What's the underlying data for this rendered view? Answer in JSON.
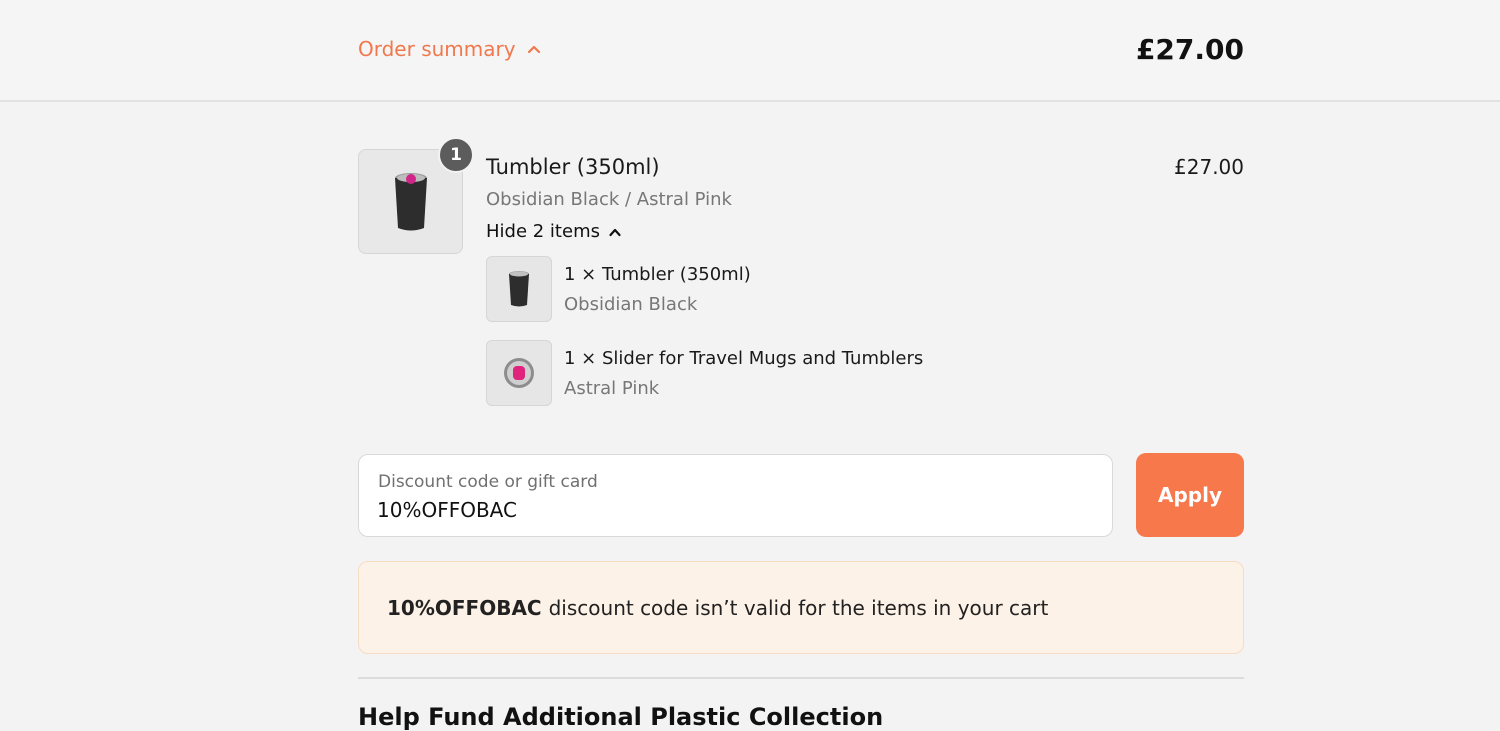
{
  "header": {
    "summary_label": "Order summary",
    "total": "£27.00"
  },
  "product": {
    "quantity": "1",
    "title": "Tumbler (350ml)",
    "variant": "Obsidian Black / Astral Pink",
    "price": "£27.00",
    "toggle_label": "Hide 2 items",
    "bundle_items": [
      {
        "label": "1 × Tumbler (350ml)",
        "variant": "Obsidian Black"
      },
      {
        "label": "1 × Slider for Travel Mugs and Tumblers",
        "variant": "Astral Pink"
      }
    ]
  },
  "discount": {
    "label": "Discount code or gift card",
    "value": "10%OFFOBAC",
    "apply_label": "Apply"
  },
  "notice": {
    "code": "10%OFFOBAC",
    "message": "discount code isn’t valid for the items in your cart"
  },
  "next_section": {
    "title": "Help Fund Additional Plastic Collection"
  },
  "colors": {
    "accent": "#f7784a",
    "notice_bg": "#fdf2e8",
    "badge": "#5c5c5c"
  },
  "icons": {
    "summary_toggle": "chevron-up-icon",
    "hide_items": "chevron-up-icon"
  }
}
